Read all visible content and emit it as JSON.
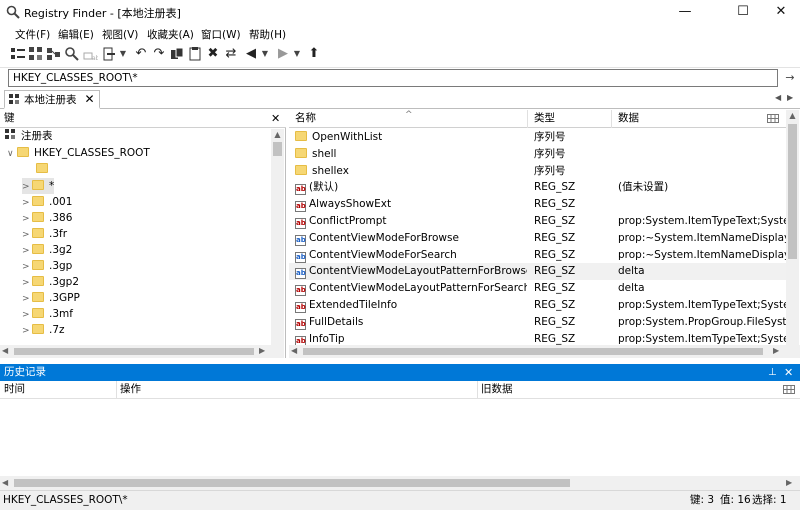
{
  "window": {
    "title": "Registry Finder - [本地注册表]",
    "minimize": "—",
    "maximize": "☐",
    "close": "✕"
  },
  "menu": [
    "文件(F)",
    "编辑(E)",
    "视图(V)",
    "收藏夹(A)",
    "窗口(W)",
    "帮助(H)"
  ],
  "address": {
    "value": "HKEY_CLASSES_ROOT\\*"
  },
  "tab": {
    "label": "本地注册表",
    "close": "✕"
  },
  "left_pane": {
    "header": "键",
    "close": "✕",
    "root_label": "注册表",
    "hive": "HKEY_CLASSES_ROOT",
    "keys": [
      "*",
      ".001",
      ".386",
      ".3fr",
      ".3g2",
      ".3gp",
      ".3gp2",
      ".3GPP",
      ".3mf",
      ".7z"
    ]
  },
  "right_pane": {
    "columns": {
      "name": "名称",
      "type": "类型",
      "data": "数据"
    },
    "rows": [
      {
        "name": "OpenWithList",
        "type": "序列号",
        "data": "",
        "icon": "folder"
      },
      {
        "name": "shell",
        "type": "序列号",
        "data": "",
        "icon": "folder"
      },
      {
        "name": "shellex",
        "type": "序列号",
        "data": "",
        "icon": "folder"
      },
      {
        "name": "(默认)",
        "type": "REG_SZ",
        "data": "(值未设置)",
        "icon": "string"
      },
      {
        "name": "AlwaysShowExt",
        "type": "REG_SZ",
        "data": "",
        "icon": "string"
      },
      {
        "name": "ConflictPrompt",
        "type": "REG_SZ",
        "data": "prop:System.ItemTypeText;System.S",
        "icon": "string"
      },
      {
        "name": "ContentViewModeForBrowse",
        "type": "REG_SZ",
        "data": "prop:~System.ItemNameDisplay;Sys",
        "icon": "string"
      },
      {
        "name": "ContentViewModeForSearch",
        "type": "REG_SZ",
        "data": "prop:~System.ItemNameDisplay;~Sy",
        "icon": "string"
      },
      {
        "name": "ContentViewModeLayoutPatternForBrowse",
        "type": "REG_SZ",
        "data": "delta",
        "icon": "string",
        "selected": true
      },
      {
        "name": "ContentViewModeLayoutPatternForSearch",
        "type": "REG_SZ",
        "data": "delta",
        "icon": "string"
      },
      {
        "name": "ExtendedTileInfo",
        "type": "REG_SZ",
        "data": "prop:System.ItemTypeText;System.S",
        "icon": "string"
      },
      {
        "name": "FullDetails",
        "type": "REG_SZ",
        "data": "prop:System.PropGroup.FileSystem;",
        "icon": "string"
      },
      {
        "name": "InfoTip",
        "type": "REG_SZ",
        "data": "prop:System.ItemTypeText;System.S",
        "icon": "string"
      }
    ]
  },
  "history": {
    "title": "历史记录",
    "pin": "⊥",
    "close": "✕",
    "columns": {
      "time": "时间",
      "action": "操作",
      "old_data": "旧数据"
    }
  },
  "status": {
    "path": "HKEY_CLASSES_ROOT\\*",
    "keys": "键: 3",
    "values": "值: 16",
    "selected": "选择: 1"
  },
  "colors": {
    "accent": "#0078d7",
    "folder": "#f6d774"
  }
}
